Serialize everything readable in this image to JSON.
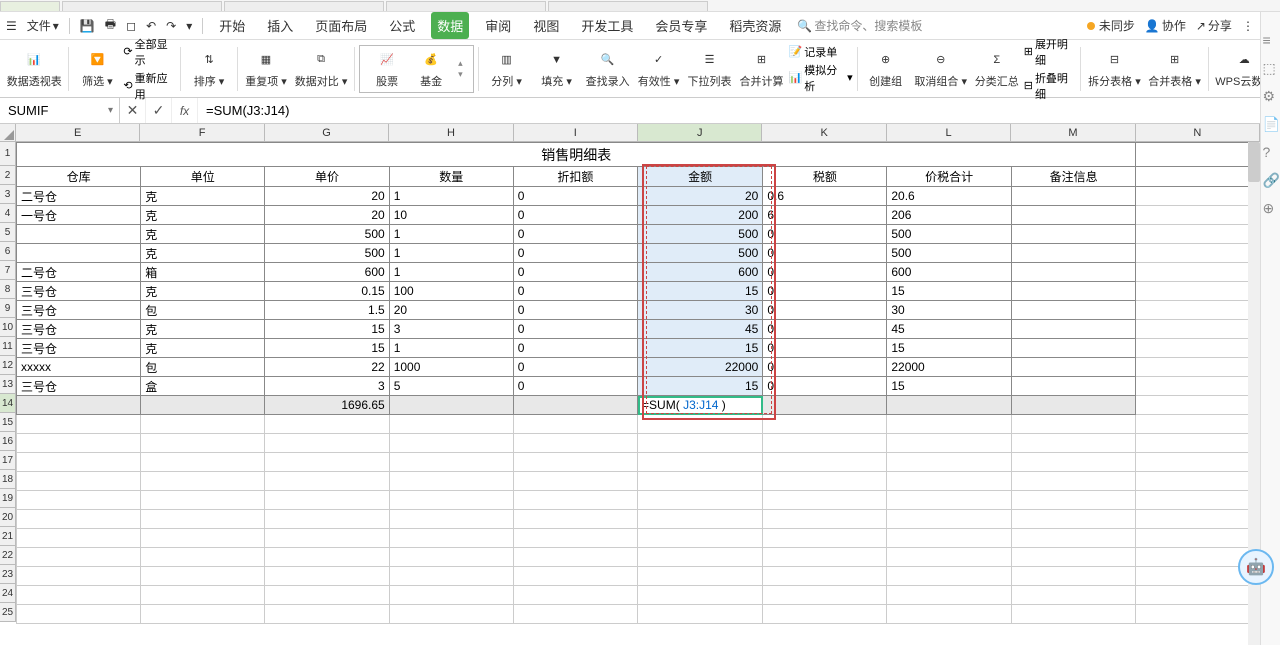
{
  "tabs": {
    "file1": "",
    "file2": "",
    "file3": "",
    "file4": ""
  },
  "filebar": {
    "file_label": "文件",
    "ribbon": {
      "start": "开始",
      "insert": "插入",
      "pagelayout": "页面布局",
      "formula": "公式",
      "data": "数据",
      "review": "审阅",
      "view": "视图",
      "devtools": "开发工具",
      "member": "会员专享",
      "resources": "稻壳资源",
      "search_placeholder": "查找命令、搜索模板"
    },
    "right": {
      "unsynced": "未同步",
      "collab": "协作",
      "share": "分享"
    }
  },
  "ribbon": {
    "pivot": "数据透视表",
    "filter": "筛选",
    "reapply": "全部显示",
    "reapply2": "重新应用",
    "sort": "排序",
    "highlight": "重复项",
    "compare": "数据对比",
    "stock": "股票",
    "fund": "基金",
    "split": "分列",
    "fill": "填充",
    "find_record": "查找录入",
    "validation": "有效性",
    "dropdown": "下拉列表",
    "merge": "合并计算",
    "record_macro": "记录单",
    "simulate": "模拟分析",
    "create_group": "创建组",
    "ungroup": "取消组合",
    "subtotal": "分类汇总",
    "show_detail": "展开明细",
    "hide_detail": "折叠明细",
    "split_table": "拆分表格",
    "merge_table": "合并表格",
    "wps": "WPS云数据"
  },
  "formula_bar": {
    "name_box": "SUMIF",
    "formula": "=SUM(J3:J14)"
  },
  "sheet": {
    "title": "销售明细表",
    "cols": [
      "E",
      "F",
      "G",
      "H",
      "I",
      "J",
      "K",
      "L",
      "M",
      "N"
    ],
    "headers": {
      "E": "仓库",
      "F": "单位",
      "G": "单价",
      "H": "数量",
      "I": "折扣额",
      "J": "金额",
      "K": "税额",
      "L": "价税合计",
      "M": "备注信息"
    },
    "rows": [
      {
        "E": "二号仓",
        "F": "克",
        "G": "20",
        "H": "1",
        "I": "0",
        "J": "20",
        "K": "0.6",
        "L": "20.6",
        "M": ""
      },
      {
        "E": "一号仓",
        "F": "克",
        "G": "20",
        "H": "10",
        "I": "0",
        "J": "200",
        "K": "6",
        "L": "206",
        "M": ""
      },
      {
        "E": "",
        "F": "克",
        "G": "500",
        "H": "1",
        "I": "0",
        "J": "500",
        "K": "0",
        "L": "500",
        "M": ""
      },
      {
        "E": "",
        "F": "克",
        "G": "500",
        "H": "1",
        "I": "0",
        "J": "500",
        "K": "0",
        "L": "500",
        "M": ""
      },
      {
        "E": "二号仓",
        "F": "箱",
        "G": "600",
        "H": "1",
        "I": "0",
        "J": "600",
        "K": "0",
        "L": "600",
        "M": ""
      },
      {
        "E": "三号仓",
        "F": "克",
        "G": "0.15",
        "H": "100",
        "I": "0",
        "J": "15",
        "K": "0",
        "L": "15",
        "M": ""
      },
      {
        "E": "三号仓",
        "F": "包",
        "G": "1.5",
        "H": "20",
        "I": "0",
        "J": "30",
        "K": "0",
        "L": "30",
        "M": ""
      },
      {
        "E": "三号仓",
        "F": "克",
        "G": "15",
        "H": "3",
        "I": "0",
        "J": "45",
        "K": "0",
        "L": "45",
        "M": ""
      },
      {
        "E": "三号仓",
        "F": "克",
        "G": "15",
        "H": "1",
        "I": "0",
        "J": "15",
        "K": "0",
        "L": "15",
        "M": ""
      },
      {
        "E": "xxxxx",
        "F": "包",
        "G": "22",
        "H": "1000",
        "I": "0",
        "J": "22000",
        "K": "0",
        "L": "22000",
        "M": ""
      },
      {
        "E": "三号仓",
        "F": "盒",
        "G": "3",
        "H": "5",
        "I": "0",
        "J": "15",
        "K": "0",
        "L": "15",
        "M": ""
      }
    ],
    "sum_row": {
      "G": "1696.65",
      "J_formula": "=SUM( J3:J14 )"
    },
    "visible_row_numbers": [
      1,
      2,
      3,
      4,
      5,
      6,
      7,
      8,
      9,
      10,
      11,
      12,
      13,
      14,
      15,
      16,
      17,
      18,
      19,
      20,
      21,
      22,
      23,
      24,
      25
    ]
  },
  "chart_data": {
    "type": "table",
    "title": "销售明细表",
    "columns": [
      "仓库",
      "单位",
      "单价",
      "数量",
      "折扣额",
      "金额",
      "税额",
      "价税合计",
      "备注信息"
    ],
    "rows": [
      [
        "二号仓",
        "克",
        20,
        1,
        0,
        20,
        0.6,
        20.6,
        ""
      ],
      [
        "一号仓",
        "克",
        20,
        10,
        0,
        200,
        6,
        206,
        ""
      ],
      [
        "",
        "克",
        500,
        1,
        0,
        500,
        0,
        500,
        ""
      ],
      [
        "",
        "克",
        500,
        1,
        0,
        500,
        0,
        500,
        ""
      ],
      [
        "二号仓",
        "箱",
        600,
        1,
        0,
        600,
        0,
        600,
        ""
      ],
      [
        "三号仓",
        "克",
        0.15,
        100,
        0,
        15,
        0,
        15,
        ""
      ],
      [
        "三号仓",
        "包",
        1.5,
        20,
        0,
        30,
        0,
        30,
        ""
      ],
      [
        "三号仓",
        "克",
        15,
        3,
        0,
        45,
        0,
        45,
        ""
      ],
      [
        "三号仓",
        "克",
        15,
        1,
        0,
        15,
        0,
        15,
        ""
      ],
      [
        "xxxxx",
        "包",
        22,
        1000,
        0,
        22000,
        0,
        22000,
        ""
      ],
      [
        "三号仓",
        "盒",
        3,
        5,
        0,
        15,
        0,
        15,
        ""
      ]
    ],
    "totals": {
      "单价": 1696.65
    }
  }
}
